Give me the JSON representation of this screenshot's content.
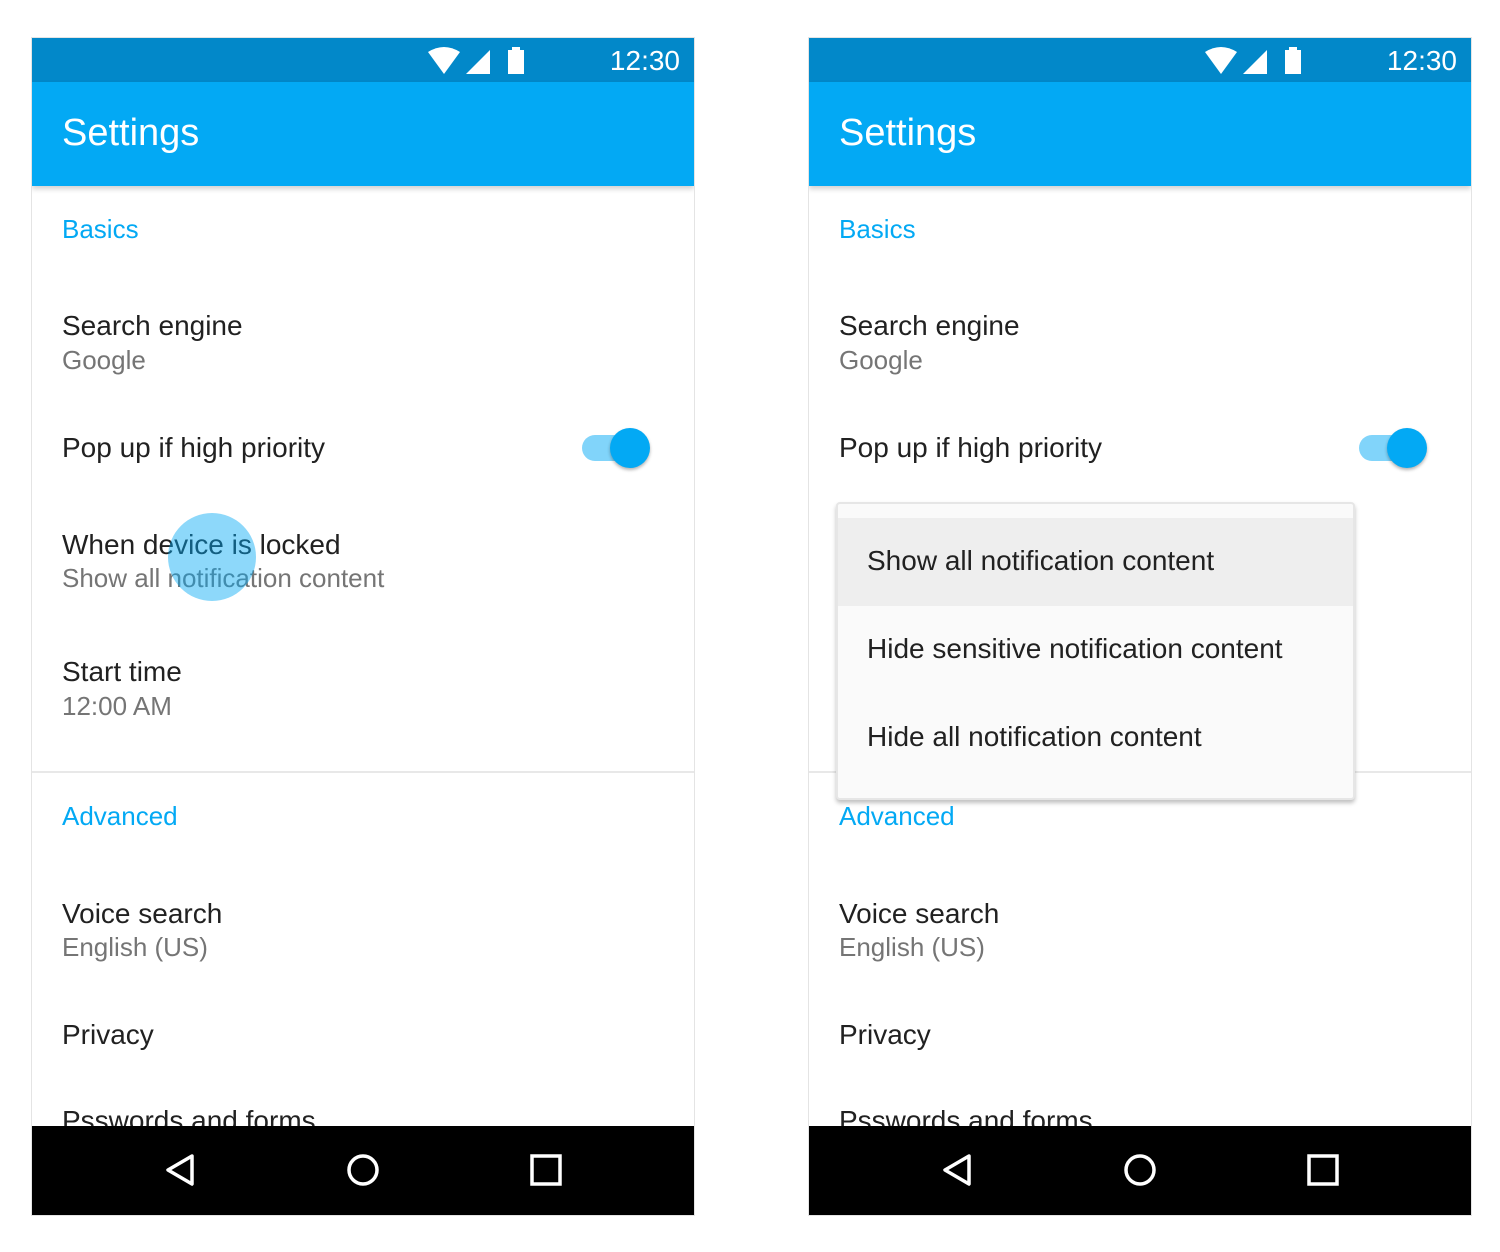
{
  "status_bar": {
    "time": "12:30",
    "icons": [
      "wifi-icon",
      "signal-icon",
      "battery-icon"
    ]
  },
  "app_bar": {
    "title": "Settings"
  },
  "colors": {
    "primary": "#03a9f4",
    "primary_dark": "#0288c9",
    "accent_track": "#81d4fa"
  },
  "sections": {
    "basics": "Basics",
    "advanced": "Advanced"
  },
  "items": {
    "search_engine": {
      "title": "Search engine",
      "value": "Google"
    },
    "popup": {
      "title": "Pop up if high priority",
      "toggle_on": true
    },
    "locked": {
      "title": "When device is locked",
      "value": "Show all notification content"
    },
    "start_time": {
      "title": "Start time",
      "value": "12:00 AM"
    },
    "voice_search": {
      "title": "Voice search",
      "value": "English (US)"
    },
    "privacy": {
      "title": "Privacy"
    },
    "passwords": {
      "title": "Psswords and forms"
    }
  },
  "dropdown": {
    "options": [
      "Show all notification content",
      "Hide sensitive notification content",
      "Hide all notification content"
    ],
    "selected": "Show all notification content"
  },
  "nav_bar": {
    "icons": [
      "back-icon",
      "home-icon",
      "recents-icon"
    ]
  }
}
